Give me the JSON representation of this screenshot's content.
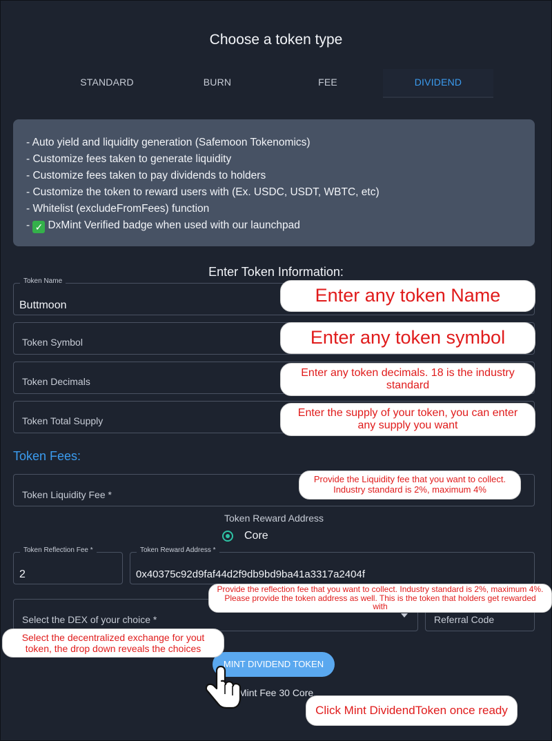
{
  "title": "Choose a token type",
  "tabs": [
    {
      "label": "STANDARD",
      "active": false
    },
    {
      "label": "BURN",
      "active": false
    },
    {
      "label": "FEE",
      "active": false
    },
    {
      "label": "DIVIDEND",
      "active": true
    }
  ],
  "features": [
    "- Auto yield and liquidity generation (Safemoon Tokenomics)",
    "- Customize fees taken to generate liquidity",
    "- Customize fees taken to pay dividends to holders",
    "- Customize the token to reward users with (Ex. USDC, USDT, WBTC, etc)",
    "- Whitelist (excludeFromFees) function",
    "DxMint Verified badge when used with our launchpad"
  ],
  "feature_prefix": "- ",
  "section_title": "Enter Token Information:",
  "form": {
    "token_name": {
      "label": "Token Name",
      "value": "Buttmoon"
    },
    "token_symbol": {
      "placeholder": "Token Symbol"
    },
    "token_decimals": {
      "placeholder": "Token Decimals"
    },
    "token_total_supply": {
      "placeholder": "Token Total Supply"
    },
    "fees_title": "Token Fees:",
    "liquidity_fee": {
      "placeholder": "Token Liquidity Fee *"
    },
    "reward_address_title": "Token Reward Address",
    "reward_option": "Core",
    "reflection_fee": {
      "label": "Token Reflection Fee *",
      "value": "2"
    },
    "reward_address": {
      "label": "Token Reward Address *",
      "value": "0x40375c92d9faf44d2f9db9bd9ba41a3317a2404f"
    },
    "dex_select": {
      "placeholder": "Select the DEX of your choice *"
    },
    "referral_code": {
      "placeholder": "Referral Code"
    },
    "mint_button": "MINT DIVIDEND TOKEN",
    "mint_fee": "Mint Fee 30 Core"
  },
  "annotations": {
    "name": "Enter any token Name",
    "symbol": "Enter any token symbol",
    "decimals": "Enter any token decimals. 18 is the industry standard",
    "supply": "Enter the supply of your token, you can enter any supply you want",
    "liquidity": "Provide the Liquidity fee that you want to collect. Industry standard is 2%, maximum 4%",
    "reflection": "Provide the reflection fee that you want to collect. Industry standard is 2%, maximum 4%. Please provide the token address as well. This is the token that holders get rewarded with",
    "dex": "Select the decentralized exchange for yout token, the drop down reveals the choices",
    "mint": "Click Mint DividendToken once ready"
  },
  "colors": {
    "background": "#1d232f",
    "accent": "#3b9cf0",
    "button": "#5aa8ef",
    "radio": "#2ec3a5",
    "annotation_text": "#e01b1b",
    "badge_check": "#34b14a"
  },
  "icons": {
    "check": "check-badge-icon",
    "caret": "chevron-down-icon",
    "cursor": "hand-pointer-icon"
  }
}
